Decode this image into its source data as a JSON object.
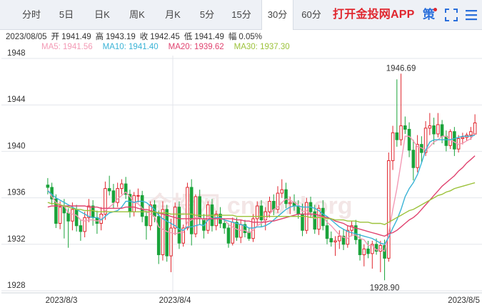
{
  "tabs": [
    {
      "label": "分时",
      "active": false
    },
    {
      "label": "5日",
      "active": false
    },
    {
      "label": "日K",
      "active": false
    },
    {
      "label": "周K",
      "active": false
    },
    {
      "label": "月K",
      "active": false
    },
    {
      "label": "5分",
      "active": false
    },
    {
      "label": "15分",
      "active": false
    },
    {
      "label": "30分",
      "active": true
    },
    {
      "label": "60分",
      "active": false
    }
  ],
  "promo": {
    "label": "打开金投网APP"
  },
  "toolbar": {
    "strategy_label": "策",
    "icons": [
      "strategy-icon",
      "fullscreen-icon",
      "menu-icon"
    ],
    "strategy_color": "#2a6fdb",
    "notice_dot_color": "#e0262e"
  },
  "info": {
    "date": "2023/08/05",
    "open_label": "开",
    "open": "1941.49",
    "high_label": "高",
    "high": "1943.19",
    "close_label": "收",
    "close": "1942.45",
    "low_label": "低",
    "low": "1941.49",
    "range_label": "幅",
    "range": "0.05%"
  },
  "ma_legend": [
    {
      "label": "MA5: 1941.56",
      "color": "#f39ab5"
    },
    {
      "label": "MA10: 1941.40",
      "color": "#3ab3d6"
    },
    {
      "label": "MA20: 1939.62",
      "color": "#e0426f"
    },
    {
      "label": "MA30: 1937.30",
      "color": "#9cc23a"
    }
  ],
  "watermark": "金投网 cngold.org",
  "chart_data": {
    "type": "candlestick",
    "interval": "30分",
    "y_ticks": [
      "1948",
      "1944",
      "1940",
      "1936",
      "1932",
      "1928"
    ],
    "ylim": [
      1928,
      1948
    ],
    "x_labels": [
      "2023/8/3",
      "2023/8/4",
      "2023/8/5"
    ],
    "annotations": [
      {
        "label": "1946.69",
        "type": "high",
        "value": 1946.69
      },
      {
        "label": "1928.90",
        "type": "low",
        "value": 1928.9
      }
    ],
    "up_color": "#e0262e",
    "down_color": "#1aa33a",
    "candles": [
      [
        1937.1,
        1937.7,
        1936.3,
        1936.9
      ],
      [
        1936.9,
        1937.3,
        1935.4,
        1935.9
      ],
      [
        1935.9,
        1936.3,
        1933.4,
        1933.8
      ],
      [
        1933.8,
        1935.7,
        1933.3,
        1935.2
      ],
      [
        1935.2,
        1935.9,
        1932.5,
        1934.7
      ],
      [
        1934.7,
        1935.1,
        1931.7,
        1934.0
      ],
      [
        1934.0,
        1935.6,
        1933.2,
        1935.0
      ],
      [
        1935.0,
        1935.4,
        1933.1,
        1933.6
      ],
      [
        1933.6,
        1934.1,
        1932.3,
        1933.1
      ],
      [
        1933.1,
        1934.8,
        1932.6,
        1934.3
      ],
      [
        1934.3,
        1935.9,
        1933.9,
        1935.3
      ],
      [
        1935.3,
        1935.8,
        1933.6,
        1934.3
      ],
      [
        1934.3,
        1934.9,
        1932.9,
        1933.8
      ],
      [
        1933.8,
        1935.2,
        1933.2,
        1934.6
      ],
      [
        1934.6,
        1937.4,
        1934.1,
        1936.8
      ],
      [
        1936.8,
        1937.9,
        1936.2,
        1936.6
      ],
      [
        1936.6,
        1937.2,
        1935.1,
        1935.6
      ],
      [
        1935.6,
        1937.3,
        1935.2,
        1936.8
      ],
      [
        1936.8,
        1937.6,
        1936.3,
        1937.2
      ],
      [
        1937.2,
        1937.8,
        1935.9,
        1936.3
      ],
      [
        1936.3,
        1936.7,
        1934.3,
        1934.8
      ],
      [
        1934.8,
        1936.5,
        1934.4,
        1936.2
      ],
      [
        1936.2,
        1936.8,
        1935.6,
        1936.2
      ],
      [
        1936.2,
        1936.6,
        1933.9,
        1934.4
      ],
      [
        1934.4,
        1934.9,
        1932.4,
        1933.6
      ],
      [
        1933.6,
        1935.7,
        1933.2,
        1935.4
      ],
      [
        1935.4,
        1935.8,
        1933.9,
        1934.4
      ],
      [
        1934.4,
        1934.9,
        1930.3,
        1931.1
      ],
      [
        1931.1,
        1935.7,
        1930.6,
        1935.0
      ],
      [
        1935.0,
        1935.4,
        1930.5,
        1931.0
      ],
      [
        1931.0,
        1934.2,
        1929.6,
        1933.4
      ],
      [
        1933.4,
        1935.6,
        1932.8,
        1935.2
      ],
      [
        1935.2,
        1935.7,
        1931.6,
        1932.1
      ],
      [
        1932.1,
        1933.7,
        1931.8,
        1933.4
      ],
      [
        1933.4,
        1937.3,
        1933.2,
        1936.9
      ],
      [
        1936.9,
        1937.6,
        1931.9,
        1932.9
      ],
      [
        1932.9,
        1936.3,
        1932.6,
        1936.1
      ],
      [
        1936.1,
        1936.7,
        1933.7,
        1934.2
      ],
      [
        1934.2,
        1934.6,
        1932.5,
        1933.2
      ],
      [
        1933.2,
        1935.7,
        1932.9,
        1935.4
      ],
      [
        1935.4,
        1935.9,
        1933.1,
        1933.6
      ],
      [
        1933.6,
        1934.9,
        1933.2,
        1934.6
      ],
      [
        1934.6,
        1935.2,
        1933.4,
        1933.8
      ],
      [
        1933.8,
        1934.2,
        1932.9,
        1933.4
      ],
      [
        1933.4,
        1933.8,
        1931.7,
        1932.1
      ],
      [
        1932.1,
        1934.3,
        1931.9,
        1933.9
      ],
      [
        1933.9,
        1934.3,
        1932.3,
        1932.6
      ],
      [
        1932.6,
        1934.1,
        1932.1,
        1933.7
      ],
      [
        1933.7,
        1934.1,
        1932.6,
        1933.0
      ],
      [
        1933.0,
        1933.4,
        1932.3,
        1932.5
      ],
      [
        1932.5,
        1934.6,
        1932.2,
        1934.2
      ],
      [
        1934.2,
        1935.7,
        1933.6,
        1935.3
      ],
      [
        1935.3,
        1935.8,
        1933.5,
        1934.1
      ],
      [
        1934.1,
        1935.2,
        1933.2,
        1934.8
      ],
      [
        1934.8,
        1936.1,
        1934.3,
        1935.7
      ],
      [
        1935.7,
        1936.3,
        1934.5,
        1935.0
      ],
      [
        1935.0,
        1937.0,
        1934.7,
        1936.4
      ],
      [
        1936.4,
        1937.6,
        1936.0,
        1936.7
      ],
      [
        1936.7,
        1937.3,
        1935.1,
        1935.5
      ],
      [
        1935.5,
        1936.1,
        1934.6,
        1935.6
      ],
      [
        1935.6,
        1936.3,
        1934.9,
        1935.3
      ],
      [
        1935.3,
        1935.8,
        1934.2,
        1934.6
      ],
      [
        1934.6,
        1935.5,
        1932.7,
        1933.2
      ],
      [
        1933.2,
        1936.0,
        1932.9,
        1935.6
      ],
      [
        1935.6,
        1936.1,
        1934.3,
        1934.8
      ],
      [
        1934.8,
        1935.4,
        1932.9,
        1933.3
      ],
      [
        1933.3,
        1935.4,
        1932.8,
        1935.1
      ],
      [
        1935.1,
        1935.8,
        1933.2,
        1933.6
      ],
      [
        1933.6,
        1934.1,
        1932.0,
        1932.5
      ],
      [
        1932.5,
        1933.1,
        1931.8,
        1932.2
      ],
      [
        1932.2,
        1932.7,
        1931.0,
        1932.3
      ],
      [
        1932.3,
        1933.2,
        1931.6,
        1932.7
      ],
      [
        1932.7,
        1933.3,
        1931.5,
        1932.0
      ],
      [
        1932.0,
        1933.6,
        1931.7,
        1933.2
      ],
      [
        1933.2,
        1934.0,
        1932.7,
        1933.6
      ],
      [
        1933.6,
        1934.1,
        1932.0,
        1932.4
      ],
      [
        1932.4,
        1932.9,
        1930.6,
        1931.1
      ],
      [
        1931.1,
        1932.0,
        1930.1,
        1931.6
      ],
      [
        1931.6,
        1932.3,
        1930.8,
        1931.2
      ],
      [
        1931.2,
        1932.3,
        1929.9,
        1932.0
      ],
      [
        1932.0,
        1932.5,
        1931.1,
        1931.4
      ],
      [
        1931.4,
        1932.3,
        1929.6,
        1931.9
      ],
      [
        1931.9,
        1932.4,
        1928.9,
        1930.8
      ],
      [
        1930.8,
        1939.9,
        1930.5,
        1939.2
      ],
      [
        1939.2,
        1942.2,
        1938.4,
        1941.6
      ],
      [
        1941.6,
        1946.2,
        1940.4,
        1941.0
      ],
      [
        1941.0,
        1946.69,
        1940.5,
        1942.2
      ],
      [
        1942.2,
        1943.0,
        1941.5,
        1941.9
      ],
      [
        1941.9,
        1942.5,
        1939.5,
        1940.1
      ],
      [
        1940.1,
        1941.0,
        1937.5,
        1938.6
      ],
      [
        1938.6,
        1941.4,
        1938.2,
        1940.6
      ],
      [
        1940.6,
        1941.3,
        1939.0,
        1939.9
      ],
      [
        1939.9,
        1942.6,
        1939.6,
        1942.0
      ],
      [
        1942.0,
        1943.3,
        1941.4,
        1942.2
      ],
      [
        1942.2,
        1942.9,
        1940.6,
        1941.5
      ],
      [
        1941.5,
        1943.3,
        1941.2,
        1942.3
      ],
      [
        1942.3,
        1942.7,
        1940.7,
        1941.3
      ],
      [
        1941.3,
        1941.8,
        1940.0,
        1940.5
      ],
      [
        1940.5,
        1941.9,
        1940.2,
        1941.7
      ],
      [
        1941.7,
        1942.1,
        1939.6,
        1940.2
      ],
      [
        1940.2,
        1941.4,
        1939.9,
        1941.1
      ],
      [
        1941.1,
        1941.6,
        1940.6,
        1941.2
      ],
      [
        1941.2,
        1941.6,
        1940.9,
        1941.4
      ],
      [
        1941.4,
        1942.1,
        1941.0,
        1941.7
      ],
      [
        1941.49,
        1943.19,
        1941.49,
        1942.45
      ]
    ],
    "series": [
      {
        "name": "MA5",
        "color": "#f39ab5",
        "values": [
          1936.7,
          1936.1,
          1935.6,
          1935.4,
          1935.3,
          1934.7,
          1934.6,
          1934.5,
          1934.1,
          1934.0,
          1934.1,
          1934.1,
          1934.0,
          1934.1,
          1934.9,
          1935.2,
          1935.5,
          1935.9,
          1936.2,
          1936.5,
          1936.1,
          1935.6,
          1935.5,
          1935.1,
          1934.8,
          1934.6,
          1934.4,
          1933.5,
          1933.3,
          1933.1,
          1933.0,
          1932.9,
          1933.0,
          1933.0,
          1933.9,
          1934.1,
          1934.3,
          1934.3,
          1934.1,
          1934.4,
          1934.2,
          1934.2,
          1934.2,
          1934.1,
          1933.7,
          1933.5,
          1933.3,
          1933.2,
          1933.2,
          1933.0,
          1933.2,
          1933.6,
          1933.8,
          1934.1,
          1934.6,
          1935.0,
          1935.2,
          1935.6,
          1935.9,
          1935.8,
          1935.6,
          1935.4,
          1934.8,
          1934.9,
          1934.6,
          1934.2,
          1934.4,
          1934.4,
          1933.9,
          1933.6,
          1933.2,
          1932.8,
          1932.6,
          1932.5,
          1932.8,
          1932.8,
          1932.5,
          1932.4,
          1931.9,
          1931.9,
          1931.5,
          1931.6,
          1931.4,
          1933.0,
          1935.0,
          1936.8,
          1939.0,
          1941.3,
          1941.3,
          1940.9,
          1940.4,
          1940.3,
          1940.1,
          1940.4,
          1940.8,
          1941.0,
          1941.3,
          1941.3,
          1941.0,
          1940.8,
          1940.6,
          1940.7,
          1940.9,
          1941.1,
          1941.56
        ]
      },
      {
        "name": "MA10",
        "color": "#3ab3d6",
        "values": [
          1936.6,
          1936.3,
          1936.0,
          1935.8,
          1935.6,
          1935.4,
          1935.2,
          1935.0,
          1934.8,
          1934.6,
          1934.4,
          1934.3,
          1934.3,
          1934.1,
          1934.4,
          1934.7,
          1934.8,
          1934.9,
          1935.2,
          1935.7,
          1935.7,
          1935.6,
          1935.7,
          1935.7,
          1935.6,
          1935.3,
          1935.0,
          1934.5,
          1934.2,
          1934.0,
          1933.8,
          1933.6,
          1933.3,
          1933.2,
          1933.5,
          1933.5,
          1933.6,
          1933.7,
          1933.6,
          1934.1,
          1934.2,
          1934.3,
          1934.3,
          1934.1,
          1934.0,
          1933.9,
          1933.8,
          1933.7,
          1933.6,
          1933.4,
          1933.4,
          1933.5,
          1933.5,
          1933.6,
          1933.8,
          1934.1,
          1934.4,
          1934.7,
          1935.0,
          1935.2,
          1935.3,
          1935.3,
          1935.2,
          1935.2,
          1935.2,
          1935.1,
          1934.9,
          1934.6,
          1934.4,
          1934.1,
          1933.8,
          1933.5,
          1933.3,
          1933.1,
          1933.0,
          1932.9,
          1932.8,
          1932.7,
          1932.6,
          1932.5,
          1932.3,
          1932.1,
          1932.0,
          1932.6,
          1933.4,
          1934.1,
          1935.0,
          1936.1,
          1936.8,
          1937.3,
          1938.0,
          1939.0,
          1940.1,
          1940.8,
          1941.0,
          1941.0,
          1941.0,
          1941.0,
          1941.0,
          1941.1,
          1941.2,
          1941.3,
          1941.3,
          1941.3,
          1941.4
        ]
      },
      {
        "name": "MA20",
        "color": "#e0426f",
        "values": [
          1935.2,
          1935.3,
          1935.3,
          1935.3,
          1935.3,
          1935.3,
          1935.3,
          1935.3,
          1935.3,
          1935.3,
          1935.2,
          1935.2,
          1935.2,
          1935.1,
          1935.1,
          1935.1,
          1935.1,
          1935.1,
          1935.1,
          1935.2,
          1935.2,
          1935.2,
          1935.1,
          1935.0,
          1935.0,
          1934.9,
          1934.8,
          1934.7,
          1934.6,
          1934.5,
          1934.4,
          1934.3,
          1934.2,
          1934.2,
          1934.2,
          1934.2,
          1934.2,
          1934.2,
          1934.2,
          1934.2,
          1934.2,
          1934.2,
          1934.2,
          1934.2,
          1934.2,
          1934.2,
          1934.1,
          1934.1,
          1934.0,
          1934.0,
          1933.9,
          1933.9,
          1933.9,
          1933.9,
          1934.0,
          1934.0,
          1934.1,
          1934.2,
          1934.3,
          1934.4,
          1934.5,
          1934.6,
          1934.6,
          1934.6,
          1934.6,
          1934.6,
          1934.5,
          1934.4,
          1934.3,
          1934.2,
          1934.0,
          1933.9,
          1933.8,
          1933.6,
          1933.5,
          1933.4,
          1933.3,
          1933.2,
          1933.1,
          1933.0,
          1932.9,
          1932.8,
          1932.7,
          1932.9,
          1933.0,
          1933.2,
          1933.5,
          1933.8,
          1934.1,
          1934.3,
          1934.6,
          1935.0,
          1935.4,
          1935.8,
          1936.2,
          1936.6,
          1937.0,
          1937.3,
          1937.6,
          1937.9,
          1938.3,
          1938.6,
          1939.0,
          1939.3,
          1939.62
        ]
      },
      {
        "name": "MA30",
        "color": "#9cc23a",
        "values": [
          1935.6,
          1935.5,
          1935.5,
          1935.4,
          1935.3,
          1935.2,
          1935.1,
          1935.0,
          1935.0,
          1934.9,
          1934.9,
          1934.9,
          1934.8,
          1934.8,
          1934.8,
          1934.8,
          1934.8,
          1934.8,
          1934.8,
          1934.8,
          1934.8,
          1934.8,
          1934.8,
          1934.8,
          1934.8,
          1934.8,
          1934.8,
          1934.7,
          1934.7,
          1934.7,
          1934.6,
          1934.6,
          1934.6,
          1934.6,
          1934.6,
          1934.6,
          1934.5,
          1934.5,
          1934.5,
          1934.5,
          1934.5,
          1934.5,
          1934.5,
          1934.5,
          1934.5,
          1934.5,
          1934.4,
          1934.4,
          1934.4,
          1934.4,
          1934.4,
          1934.4,
          1934.4,
          1934.4,
          1934.4,
          1934.4,
          1934.4,
          1934.4,
          1934.4,
          1934.4,
          1934.4,
          1934.4,
          1934.4,
          1934.4,
          1934.3,
          1934.3,
          1934.3,
          1934.3,
          1934.2,
          1934.2,
          1934.1,
          1934.1,
          1934.1,
          1934.0,
          1934.0,
          1934.0,
          1933.9,
          1933.9,
          1933.9,
          1933.8,
          1933.8,
          1933.8,
          1933.7,
          1933.9,
          1934.1,
          1934.3,
          1934.5,
          1934.7,
          1934.9,
          1935.0,
          1935.2,
          1935.4,
          1935.6,
          1935.8,
          1936.0,
          1936.2,
          1936.3,
          1936.5,
          1936.6,
          1936.8,
          1936.9,
          1937.0,
          1937.1,
          1937.2,
          1937.3
        ]
      }
    ]
  }
}
